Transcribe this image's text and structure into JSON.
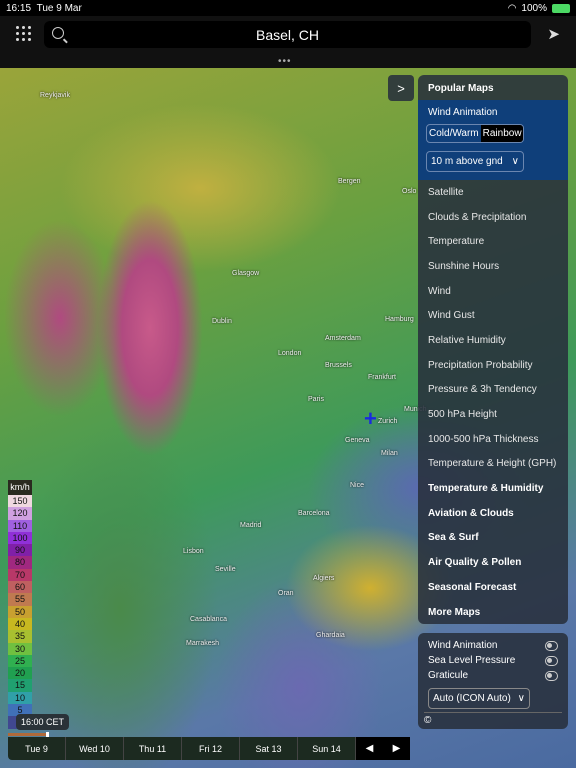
{
  "status": {
    "time": "16:15",
    "date": "Tue 9 Mar",
    "battery": "100%"
  },
  "search": {
    "value": "Basel, CH"
  },
  "cities": [
    [
      "Reykjavik",
      40,
      92
    ],
    [
      "Bergen",
      338,
      178
    ],
    [
      "Oslo",
      402,
      188
    ],
    [
      "Glasgow",
      232,
      270
    ],
    [
      "Dublin",
      212,
      318
    ],
    [
      "Hamburg",
      385,
      316
    ],
    [
      "Amsterdam",
      325,
      335
    ],
    [
      "London",
      278,
      350
    ],
    [
      "Brussels",
      325,
      362
    ],
    [
      "Frankfurt",
      368,
      374
    ],
    [
      "Paris",
      308,
      396
    ],
    [
      "Munich",
      404,
      406
    ],
    [
      "Zurich",
      378,
      418
    ],
    [
      "Geneva",
      345,
      437
    ],
    [
      "Milan",
      381,
      450
    ],
    [
      "Barcelona",
      298,
      510
    ],
    [
      "Madrid",
      240,
      522
    ],
    [
      "Nice",
      350,
      482
    ],
    [
      "Lisbon",
      183,
      548
    ],
    [
      "Seville",
      215,
      566
    ],
    [
      "Algiers",
      313,
      575
    ],
    [
      "Oran",
      278,
      590
    ],
    [
      "Casablanca",
      190,
      616
    ],
    [
      "Marrakesh",
      186,
      640
    ],
    [
      "Ghardaia",
      316,
      632
    ]
  ],
  "panel": {
    "header": "Popular Maps",
    "wind_animation": "Wind Animation",
    "styles": [
      "Cold/Warm",
      "Rainbow"
    ],
    "selected_style": "Rainbow",
    "level": "10 m above gnd",
    "items": [
      {
        "label": "Satellite",
        "bold": false
      },
      {
        "label": "Clouds & Precipitation",
        "bold": false
      },
      {
        "label": "Temperature",
        "bold": false
      },
      {
        "label": "Sunshine Hours",
        "bold": false
      },
      {
        "label": "Wind",
        "bold": false
      },
      {
        "label": "Wind Gust",
        "bold": false
      },
      {
        "label": "Relative Humidity",
        "bold": false
      },
      {
        "label": "Precipitation Probability",
        "bold": false
      },
      {
        "label": "Pressure & 3h Tendency",
        "bold": false
      },
      {
        "label": "500 hPa Height",
        "bold": false
      },
      {
        "label": "1000-500 hPa Thickness",
        "bold": false
      },
      {
        "label": "Temperature & Height (GPH)",
        "bold": false
      },
      {
        "label": "Temperature & Humidity",
        "bold": true
      },
      {
        "label": "Aviation & Clouds",
        "bold": true
      },
      {
        "label": "Sea & Surf",
        "bold": true
      },
      {
        "label": "Air Quality & Pollen",
        "bold": true
      },
      {
        "label": "Seasonal Forecast",
        "bold": true
      },
      {
        "label": "More Maps",
        "bold": true
      }
    ]
  },
  "overlays": {
    "toggles": [
      "Wind Animation",
      "Sea Level Pressure",
      "Graticule"
    ],
    "model": "Auto (ICON Auto)",
    "copyright": "©"
  },
  "legend": {
    "unit": "km/h",
    "steps": [
      [
        "150",
        "#f0d8e0"
      ],
      [
        "120",
        "#d0a0e0"
      ],
      [
        "110",
        "#a060e0"
      ],
      [
        "100",
        "#9030d8"
      ],
      [
        "90",
        "#8020a8"
      ],
      [
        "80",
        "#a02880"
      ],
      [
        "70",
        "#b83868"
      ],
      [
        "60",
        "#c06060"
      ],
      [
        "55",
        "#c07a50"
      ],
      [
        "50",
        "#c8a030"
      ],
      [
        "40",
        "#c8b820"
      ],
      [
        "35",
        "#a8c030"
      ],
      [
        "30",
        "#70c040"
      ],
      [
        "25",
        "#30b050"
      ],
      [
        "20",
        "#20a050"
      ],
      [
        "15",
        "#20a070"
      ],
      [
        "10",
        "#30a0a8"
      ],
      [
        "5",
        "#4070b8"
      ],
      [
        "",
        "#404890"
      ]
    ]
  },
  "timeline": {
    "current": "16:00 CET",
    "progress": 0.67,
    "days": [
      "Tue 9",
      "Wed 10",
      "Thu 11",
      "Fri 12",
      "Sat 13",
      "Sun 14"
    ],
    "prev": "◀",
    "next": "▶"
  }
}
